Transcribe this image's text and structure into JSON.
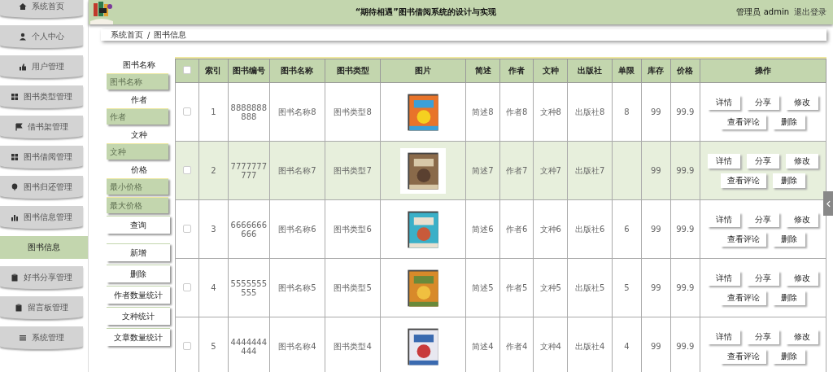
{
  "sidebar": {
    "items": [
      {
        "label": "系统首页",
        "selected": false
      },
      {
        "label": "个人中心",
        "selected": false
      },
      {
        "label": "用户管理",
        "selected": false
      },
      {
        "label": "图书类型管理",
        "selected": false
      },
      {
        "label": "借书架管理",
        "selected": false
      },
      {
        "label": "图书借阅管理",
        "selected": false
      },
      {
        "label": "图书归还管理",
        "selected": false
      },
      {
        "label": "图书信息管理",
        "selected": false
      },
      {
        "label": "图书信息",
        "selected": true
      },
      {
        "label": "好书分享管理",
        "selected": false
      },
      {
        "label": "留言板管理",
        "selected": false
      },
      {
        "label": "系统管理",
        "selected": false
      }
    ]
  },
  "header": {
    "title": "“期待相遇”图书借阅系统的设计与实现",
    "user": "管理员 admin",
    "logout": "退出登录"
  },
  "breadcrumb": [
    "系统首页",
    "/",
    "图书信息"
  ],
  "filters": [
    {
      "label": "图书名称",
      "placeholders": [
        "图书名称"
      ]
    },
    {
      "label": "作者",
      "placeholders": [
        "作者"
      ]
    },
    {
      "label": "文种",
      "placeholders": [
        "文种"
      ]
    },
    {
      "label": "价格",
      "placeholders": [
        "最小价格",
        "最大价格"
      ]
    }
  ],
  "search_button": "查询",
  "action_buttons": [
    "新增",
    "删除",
    "作者数量统计",
    "文种统计",
    "文章数量统计"
  ],
  "table": {
    "columns": [
      "索引",
      "图书编号",
      "图书名称",
      "图书类型",
      "图片",
      "简述",
      "作者",
      "文种",
      "出版社",
      "单限",
      "库存",
      "价格",
      "操作"
    ],
    "all_checked": false,
    "rows": [
      {
        "checked": false,
        "highlighted": false,
        "index": "1",
        "code": "8888888888",
        "name": "图书名称8",
        "type": "图书类型8",
        "summary": "简述8",
        "author": "作者8",
        "language": "文种8",
        "publisher": "出版社8",
        "limit": "8",
        "stock": "99",
        "price": "99.9",
        "actions": [
          "详情",
          "分享",
          "修改",
          "查看评论",
          "删除"
        ]
      },
      {
        "checked": false,
        "highlighted": true,
        "index": "2",
        "code": "7777777777",
        "name": "图书名称7",
        "type": "图书类型7",
        "summary": "简述7",
        "author": "作者7",
        "language": "文种7",
        "publisher": "出版社7",
        "limit": "",
        "stock": "99",
        "price": "99.9",
        "actions": [
          "详情",
          "分享",
          "修改",
          "查看评论",
          "删除"
        ]
      },
      {
        "checked": false,
        "highlighted": false,
        "index": "3",
        "code": "6666666666",
        "name": "图书名称6",
        "type": "图书类型6",
        "summary": "简述6",
        "author": "作者6",
        "language": "文种6",
        "publisher": "出版社6",
        "limit": "6",
        "stock": "99",
        "price": "99.9",
        "actions": [
          "详情",
          "分享",
          "修改",
          "查看评论",
          "删除"
        ]
      },
      {
        "checked": false,
        "highlighted": false,
        "index": "4",
        "code": "5555555555",
        "name": "图书名称5",
        "type": "图书类型5",
        "summary": "简述5",
        "author": "作者5",
        "language": "文种5",
        "publisher": "出版社5",
        "limit": "5",
        "stock": "99",
        "price": "99.9",
        "actions": [
          "详情",
          "分享",
          "修改",
          "查看评论",
          "删除"
        ]
      },
      {
        "checked": false,
        "highlighted": false,
        "index": "5",
        "code": "4444444444",
        "name": "图书名称4",
        "type": "图书类型4",
        "summary": "简述4",
        "author": "作者4",
        "language": "文种4",
        "publisher": "出版社4",
        "limit": "4",
        "stock": "99",
        "price": "99.9",
        "actions": [
          "详情",
          "分享",
          "修改",
          "查看评论",
          "删除"
        ]
      }
    ]
  }
}
